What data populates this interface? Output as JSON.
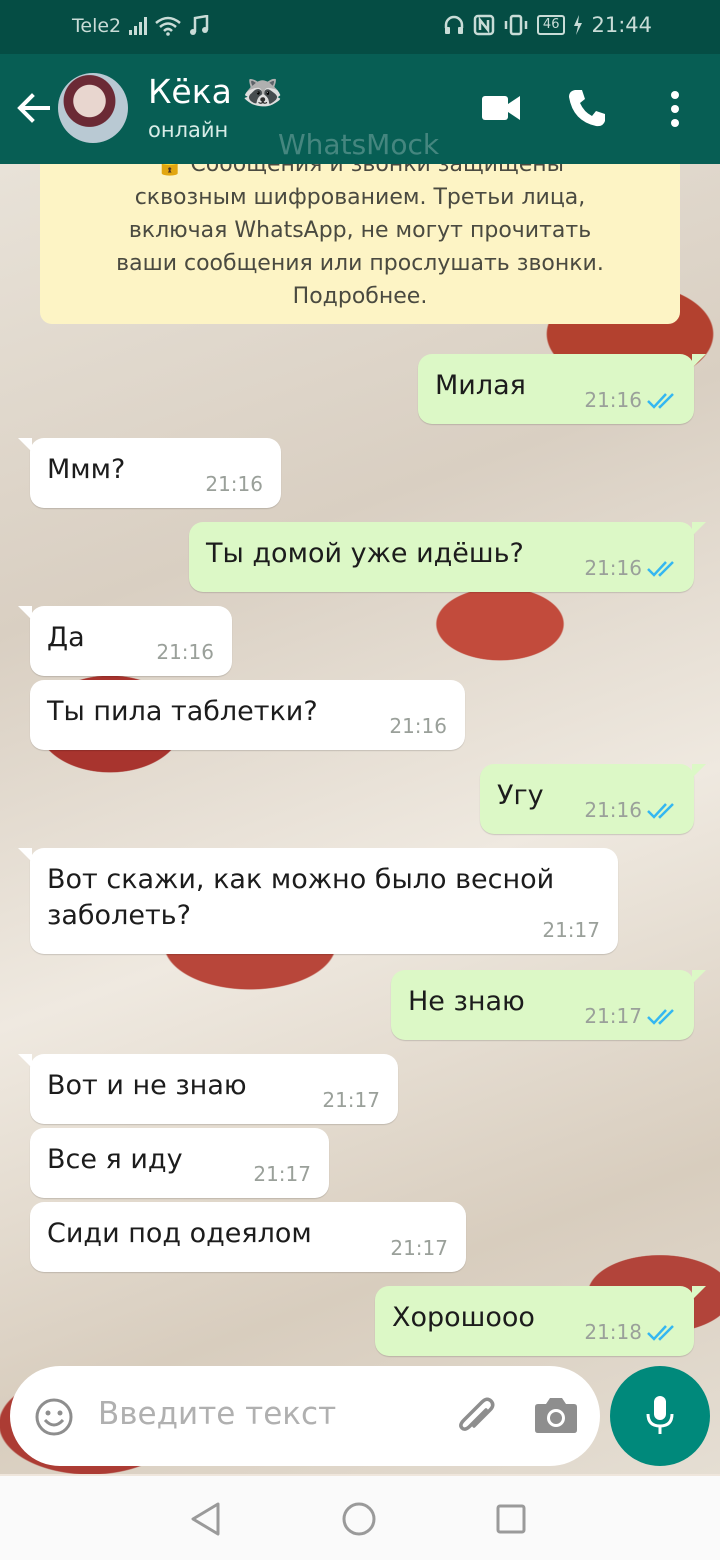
{
  "status_bar": {
    "carrier": "Tele2",
    "battery": "46",
    "time": "21:44",
    "icons": [
      "signal-icon",
      "wifi-icon",
      "music-icon",
      "headphones-icon",
      "nfc-icon",
      "vibrate-icon",
      "battery-icon",
      "charging-icon"
    ]
  },
  "header": {
    "contact_name": "Кёка 🦝",
    "contact_status": "онлайн",
    "watermark": "WhatsMock",
    "icons": [
      "back-arrow-icon",
      "video-call-icon",
      "phone-icon",
      "more-vert-icon"
    ]
  },
  "encryption_notice": "🔒 Сообщения и звонки защищены\nсквозным шифрованием. Третьи лица,\nвключая WhatsApp, не могут прочитать\nваши сообщения или прослушать звонки.\nПодробнее.",
  "messages": [
    {
      "dir": "out",
      "text": "Милая",
      "time": "21:16"
    },
    {
      "dir": "in",
      "text": "Ммм?",
      "time": "21:16"
    },
    {
      "dir": "out",
      "text": "Ты домой уже идёшь?",
      "time": "21:16"
    },
    {
      "dir": "in",
      "text": "Да",
      "time": "21:16"
    },
    {
      "dir": "in",
      "text": "Ты пила таблетки?",
      "time": "21:16"
    },
    {
      "dir": "out",
      "text": "Угу",
      "time": "21:16"
    },
    {
      "dir": "in",
      "text": "Вот скажи, как можно было весной\nзаболеть?",
      "time": "21:17"
    },
    {
      "dir": "out",
      "text": "Не знаю",
      "time": "21:17"
    },
    {
      "dir": "in",
      "text": "Вот и не знаю",
      "time": "21:17"
    },
    {
      "dir": "in",
      "text": "Все я иду",
      "time": "21:17"
    },
    {
      "dir": "in",
      "text": "Сиди под одеялом",
      "time": "21:17"
    },
    {
      "dir": "out",
      "text": "Хорошооо",
      "time": "21:18"
    }
  ],
  "input": {
    "placeholder": "Введите текст",
    "icons": [
      "emoji-icon",
      "attach-icon",
      "camera-icon",
      "mic-icon"
    ]
  },
  "colors": {
    "header": "#075e54",
    "status_bar": "#054d44",
    "outgoing_bubble": "#dcf8c6",
    "incoming_bubble": "#ffffff",
    "read_ticks": "#34b7f1",
    "mic_button": "#00897b"
  }
}
